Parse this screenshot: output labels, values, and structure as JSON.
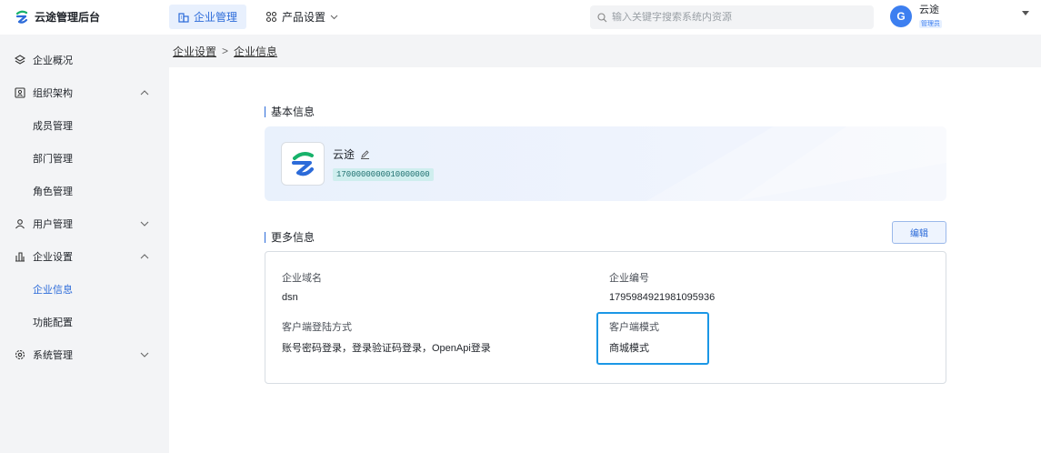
{
  "app": {
    "title": "云途管理后台"
  },
  "nav": {
    "tabs": [
      {
        "label": "企业管理",
        "icon": "building-icon"
      },
      {
        "label": "产品设置",
        "icon": "product-icon"
      }
    ]
  },
  "search": {
    "placeholder": "输入关键字搜索系统内资源"
  },
  "user": {
    "initial": "G",
    "name": "云途",
    "role": "管理员"
  },
  "sidebar": {
    "items": [
      {
        "label": "企业概况",
        "icon": "layers-icon"
      },
      {
        "label": "组织架构",
        "icon": "org-icon",
        "expanded": true
      },
      {
        "label": "成员管理"
      },
      {
        "label": "部门管理"
      },
      {
        "label": "角色管理"
      },
      {
        "label": "用户管理",
        "icon": "user-icon",
        "expanded": false
      },
      {
        "label": "企业设置",
        "icon": "enterprise-icon",
        "expanded": true
      },
      {
        "label": "企业信息",
        "active": true
      },
      {
        "label": "功能配置"
      },
      {
        "label": "系统管理",
        "icon": "settings-icon",
        "expanded": false
      }
    ]
  },
  "breadcrumb": {
    "items": [
      "企业设置",
      "企业信息"
    ],
    "separator": ">"
  },
  "basic_info": {
    "title": "基本信息",
    "company_name": "云途",
    "company_id": "1700000000010000000"
  },
  "more_info": {
    "title": "更多信息",
    "edit_label": "编辑",
    "fields": [
      {
        "label": "企业域名",
        "value": "dsn"
      },
      {
        "label": "企业编号",
        "value": "1795984921981095936"
      },
      {
        "label": "客户端登陆方式",
        "value": "账号密码登录，登录验证码登录，OpenApi登录"
      },
      {
        "label": "客户端模式",
        "value": "商城模式"
      }
    ]
  },
  "colors": {
    "accent": "#2c6bd9",
    "highlight": "#1b97e6",
    "sidebar_bg": "#f3f4f6"
  }
}
